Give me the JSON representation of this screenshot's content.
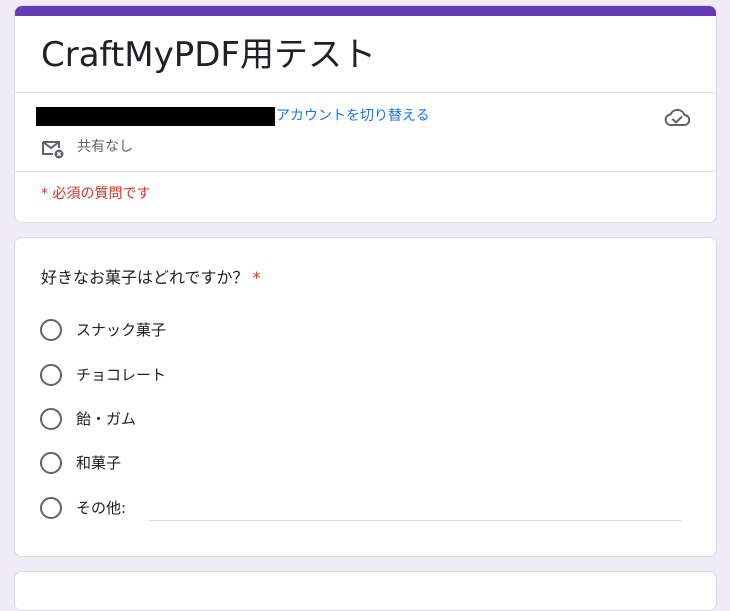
{
  "form": {
    "title": "CraftMyPDF用テスト",
    "switch_account_label": "アカウントを切り替える",
    "sharing_status": "共有なし",
    "required_note": "* 必須の質問です",
    "icons": {
      "saved": "cloud-check-icon",
      "mail": "mail-off-icon"
    },
    "accent_color": "#673ab7"
  },
  "question": {
    "title": "好きなお菓子はどれですか？",
    "required_mark": "*",
    "options": [
      {
        "label": "スナック菓子"
      },
      {
        "label": "チョコレート"
      },
      {
        "label": "飴・ガム"
      },
      {
        "label": "和菓子"
      },
      {
        "label": "その他:"
      }
    ],
    "other_value": ""
  }
}
